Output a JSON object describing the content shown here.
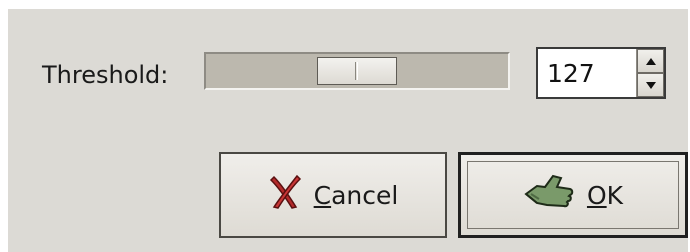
{
  "dialog": {
    "threshold_label": "Threshold:",
    "threshold_value": "127",
    "threshold_max": 255,
    "threshold_fraction": 0.498
  },
  "buttons": {
    "cancel_mnemonic": "C",
    "cancel_rest": "ancel",
    "ok_mnemonic": "O",
    "ok_rest": "K"
  },
  "icons": {
    "cancel": "cancel-x-icon",
    "ok": "ok-hand-icon"
  },
  "colors": {
    "dialog_bg": "#dcdad5",
    "trough": "#bcb8ae",
    "cancel_icon": "#b32a2a",
    "ok_icon": "#7a9a6a"
  }
}
